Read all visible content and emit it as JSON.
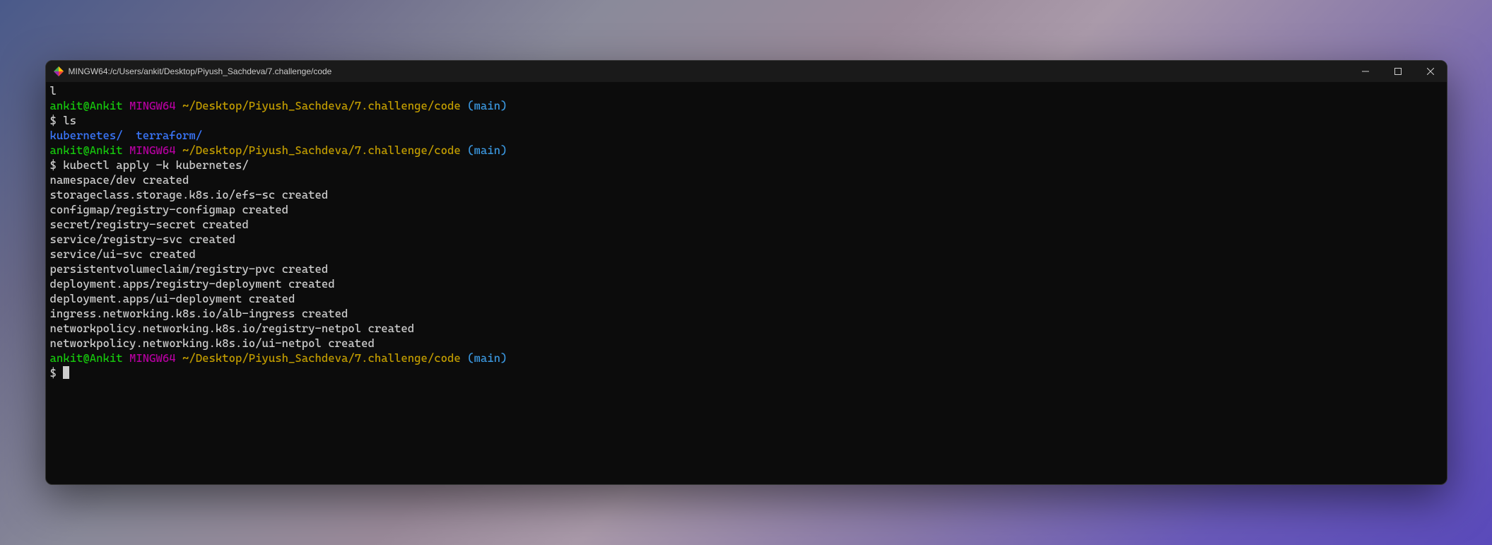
{
  "window": {
    "title": "MINGW64:/c/Users/ankit/Desktop/Piyush_Sachdeva/7.challenge/code"
  },
  "prompt": {
    "user_host": "ankit@Ankit",
    "shell": "MINGW64",
    "path": "~/Desktop/Piyush_Sachdeva/7.challenge/code",
    "branch": "(main)",
    "symbol": "$"
  },
  "truncated_top": "l",
  "blocks": [
    {
      "command": "ls",
      "output_dirs": [
        "kubernetes/",
        "terraform/"
      ]
    },
    {
      "command": "kubectl apply -k kubernetes/",
      "output_lines": [
        "namespace/dev created",
        "storageclass.storage.k8s.io/efs-sc created",
        "configmap/registry-configmap created",
        "secret/registry-secret created",
        "service/registry-svc created",
        "service/ui-svc created",
        "persistentvolumeclaim/registry-pvc created",
        "deployment.apps/registry-deployment created",
        "deployment.apps/ui-deployment created",
        "ingress.networking.k8s.io/alb-ingress created",
        "networkpolicy.networking.k8s.io/registry-netpol created",
        "networkpolicy.networking.k8s.io/ui-netpol created"
      ]
    }
  ]
}
